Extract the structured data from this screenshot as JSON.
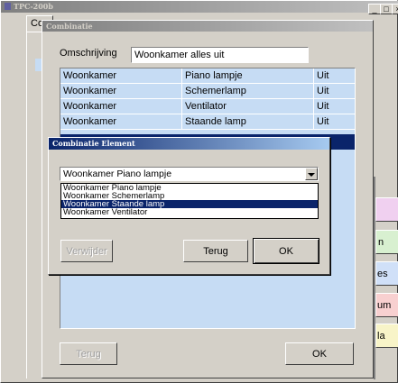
{
  "main_window": {
    "title": "TPC-200b",
    "tab_label": "Co",
    "right_buttons": [
      "n",
      "es",
      "um",
      "la"
    ]
  },
  "combinatie_dialog": {
    "title": "Combinatie",
    "omschrijving_label": "Omschrijving",
    "omschrijving_value": "Woonkamer alles uit",
    "rows": [
      {
        "room": "Woonkamer",
        "element": "Piano lampje",
        "state": "Uit"
      },
      {
        "room": "Woonkamer",
        "element": "Schemerlamp",
        "state": "Uit"
      },
      {
        "room": "Woonkamer",
        "element": "Ventilator",
        "state": "Uit"
      },
      {
        "room": "Woonkamer",
        "element": "Staande lamp",
        "state": "Uit"
      }
    ],
    "back_button": "Terug",
    "ok_button": "OK"
  },
  "element_dialog": {
    "title": "Combinatie Element",
    "selected_value": "Woonkamer Piano lampje",
    "options": [
      "Woonkamer Piano lampje",
      "Woonkamer Schemerlamp",
      "Woonkamer Staande lamp",
      "Woonkamer Ventilator"
    ],
    "highlighted_index": 2,
    "remove_button": "Verwijder",
    "back_button": "Terug",
    "ok_button": "OK"
  },
  "colors": {
    "title_active": "#0a246a",
    "title_inactive": "#808080",
    "face": "#d4d0c8",
    "grid_bg": "#c6dcf4",
    "selection": "#0a246a",
    "pink_button": "#f0d0f0",
    "green_button": "#d8f0d0",
    "blue_button": "#d0e0f8",
    "red_button": "#f8d0d0",
    "yellow_button": "#f8f4c8"
  }
}
